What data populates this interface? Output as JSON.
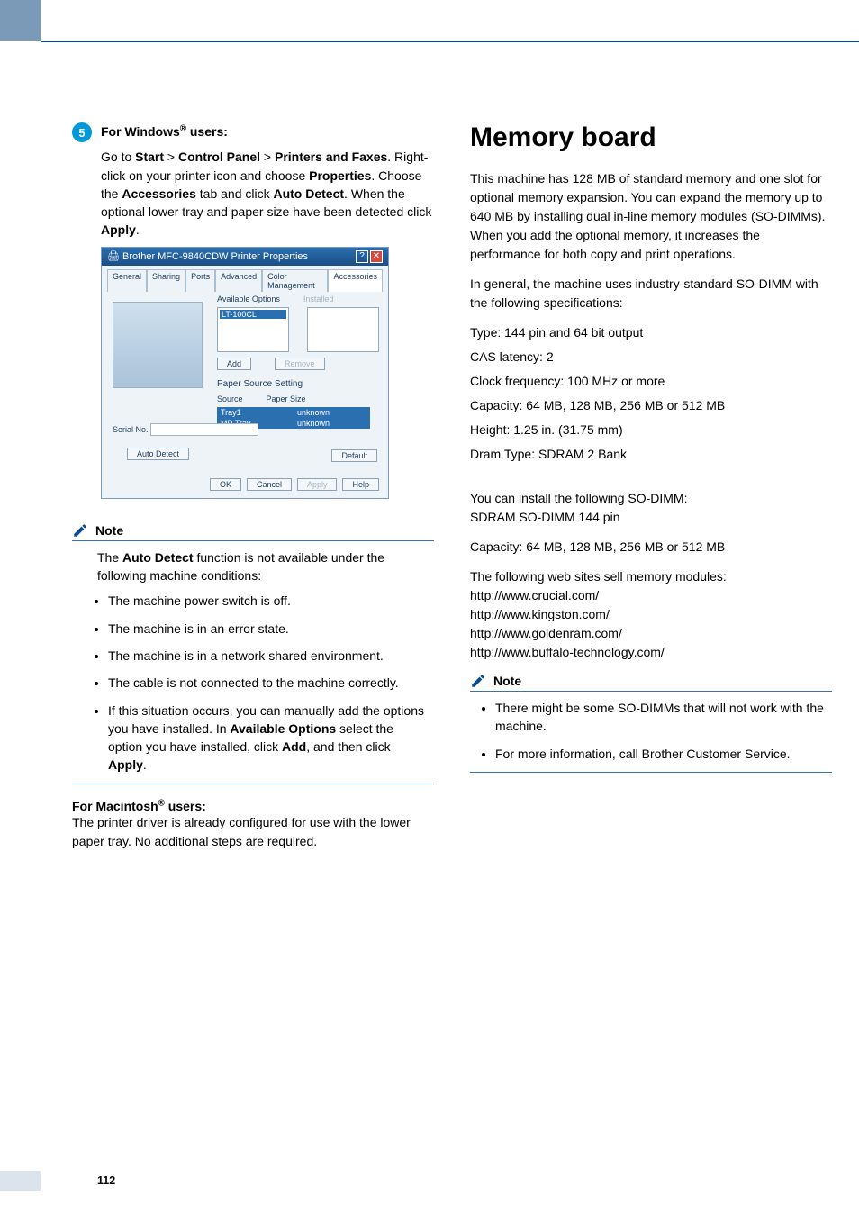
{
  "page_number": "112",
  "left": {
    "step5_number": "5",
    "win_users_label": "For Windows",
    "win_users_suffix": " users:",
    "win_users_body_1": "Go to ",
    "win_start": "Start",
    "gt": " > ",
    "win_cp": "Control Panel",
    "win_pf": "Printers and Faxes",
    "win_body_2": ". Right-click on your printer icon and choose ",
    "win_props": "Properties",
    "win_body_3": ". Choose the ",
    "win_acc": "Accessories",
    "win_body_4": " tab and click ",
    "win_auto": "Auto Detect",
    "win_body_5": ". When the optional lower tray and paper size have been detected click ",
    "win_apply": "Apply",
    "win_body_6": ".",
    "figure": {
      "title": "Brother MFC-9840CDW Printer Properties",
      "tabs": [
        "General",
        "Sharing",
        "Ports",
        "Advanced",
        "Color Management",
        "Accessories"
      ],
      "available_options": "Available Options",
      "installed": "Installed",
      "option_item": "LT-100CL",
      "add": "Add",
      "remove": "Remove",
      "paper_source_setting": "Paper Source Setting",
      "source": "Source",
      "paper_size": "Paper Size",
      "row1a": "Tray1",
      "row1b": "unknown",
      "row2a": "MP Tray",
      "row2b": "unknown",
      "serial_no": "Serial No.",
      "auto_detect": "Auto Detect",
      "default": "Default",
      "ok": "OK",
      "cancel": "Cancel",
      "apply": "Apply",
      "help": "Help"
    },
    "note_label": "Note",
    "note_intro_1": "The ",
    "note_auto": "Auto Detect",
    "note_intro_2": " function is not available under the following machine conditions:",
    "note_b1": "The machine power switch is off.",
    "note_b2": "The machine is in an error state.",
    "note_b3": "The machine is in a network shared environment.",
    "note_b4": "The cable is not connected to the machine correctly.",
    "note_b5_1": "If this situation occurs, you can manually add the options you have installed. In ",
    "note_b5_avail": "Available Options",
    "note_b5_2": " select the option you have installed, click ",
    "note_b5_add": "Add",
    "note_b5_3": ", and then click ",
    "note_b5_apply": "Apply",
    "note_b5_4": ".",
    "mac_label": "For Macintosh",
    "mac_suffix": " users:",
    "mac_body": "The printer driver is already configured for use with the lower paper tray. No additional steps are required."
  },
  "right": {
    "heading": "Memory board",
    "p1": "This machine has 128 MB of standard memory and one slot for optional memory expansion. You can expand the memory up to 640 MB by installing dual in-line memory modules (SO-DIMMs). When you add the optional memory, it increases the performance for both copy and print operations.",
    "p2": "In general, the machine uses industry-standard SO-DIMM with the following specifications:",
    "spec1": "Type: 144 pin and 64 bit output",
    "spec2": "CAS latency: 2",
    "spec3": "Clock frequency: 100 MHz or more",
    "spec4": "Capacity: 64 MB, 128 MB, 256 MB or 512 MB",
    "spec5": "Height: 1.25 in. (31.75 mm)",
    "spec6": "Dram Type: SDRAM 2 Bank",
    "p3a": "You can install the following SO-DIMM:",
    "p3b": "SDRAM SO-DIMM 144 pin",
    "p4": "Capacity: 64 MB, 128 MB, 256 MB or 512 MB",
    "p5": "The following web sites sell memory modules:",
    "url1": "http://www.crucial.com/",
    "url2": "http://www.kingston.com/",
    "url3": "http://www.goldenram.com/",
    "url4": "http://www.buffalo-technology.com/",
    "note_label": "Note",
    "nb1": "There might be some SO-DIMMs that will not work with the machine.",
    "nb2": "For more information, call Brother Customer Service."
  }
}
